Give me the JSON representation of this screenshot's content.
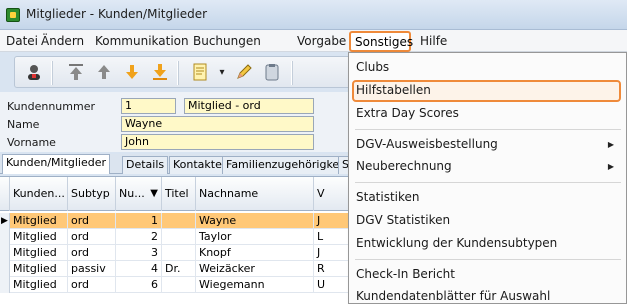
{
  "window": {
    "title": "Mitglieder - Kunden/Mitglieder"
  },
  "menubar": {
    "items": [
      "Datei",
      "Ändern",
      "Kommunikation",
      "Buchungen",
      "Vorgabe",
      "Sonstiges",
      "Hilfe"
    ]
  },
  "toolbar": {
    "icons": [
      "member-icon",
      "move-first-icon",
      "move-up-icon",
      "move-down-icon",
      "move-last-icon",
      "document-icon",
      "edit-pencil-icon",
      "clipboard-icon"
    ],
    "dropdown_glyph": "▾"
  },
  "form": {
    "kundennummer_label": "Kundennummer",
    "kundennummer_value": "1",
    "typ_value": "Mitglied - ord",
    "name_label": "Name",
    "name_value": "Wayne",
    "vorname_label": "Vorname",
    "vorname_value": "John"
  },
  "tabs": [
    "Kunden/Mitglieder",
    "Details",
    "Kontakte",
    "Familienzugehörigkeit",
    "Sc"
  ],
  "grid": {
    "columns": [
      "Kunden...",
      "Subtyp",
      "Nu...",
      "Titel",
      "Nachname",
      "V"
    ],
    "rows": [
      [
        "Mitglied",
        "ord",
        "1",
        "",
        "Wayne",
        "J"
      ],
      [
        "Mitglied",
        "ord",
        "2",
        "",
        "Taylor",
        "L"
      ],
      [
        "Mitglied",
        "ord",
        "3",
        "",
        "Knopf",
        "J"
      ],
      [
        "Mitglied",
        "passiv",
        "4",
        "Dr.",
        "Weizäcker",
        "R"
      ],
      [
        "Mitglied",
        "ord",
        "6",
        "",
        "Wiegemann",
        "U"
      ]
    ],
    "selected_row_marker": "▶",
    "sort_indicator": "▼"
  },
  "dropdown": {
    "items": [
      {
        "label": "Clubs",
        "submenu": false
      },
      {
        "label": "Hilfstabellen",
        "submenu": false,
        "highlighted": true
      },
      {
        "label": "Extra Day Scores",
        "submenu": false
      },
      {
        "label": "DGV-Ausweisbestellung",
        "submenu": true
      },
      {
        "label": "Neuberechnung",
        "submenu": true
      },
      {
        "label": "Statistiken",
        "submenu": false
      },
      {
        "label": "DGV Statistiken",
        "submenu": false
      },
      {
        "label": "Entwicklung der Kundensubtypen",
        "submenu": false
      },
      {
        "label": "Check-In Bericht",
        "submenu": false
      },
      {
        "label": "Kundendatenblätter für Auswahl",
        "submenu": false
      }
    ],
    "submenu_glyph": "▶"
  },
  "colors": {
    "highlight_border": "#ef8a3a",
    "selected_row": "#ffc877",
    "input_bg": "#fff9c8"
  }
}
